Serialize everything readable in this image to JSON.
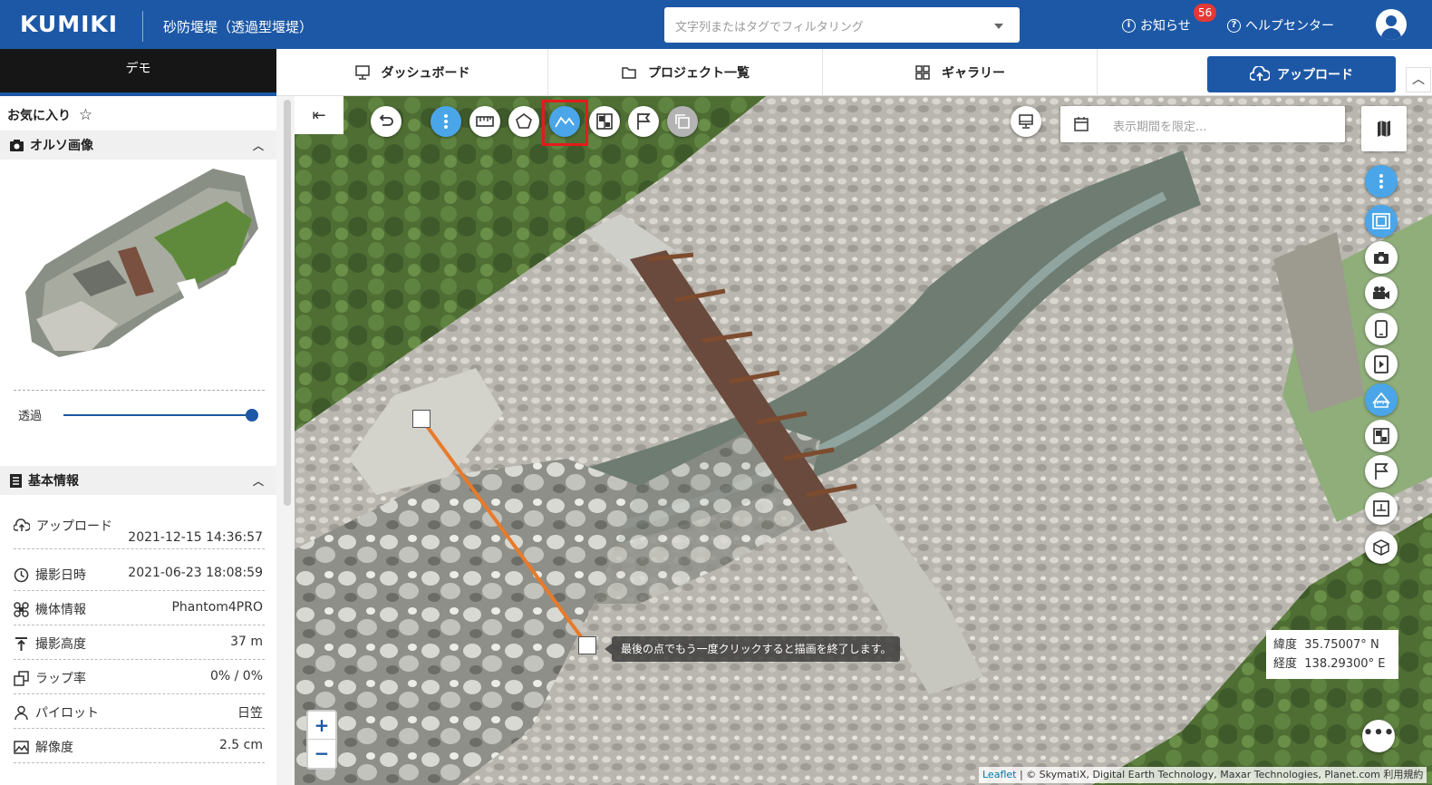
{
  "header": {
    "logo": "KUMIKI",
    "project_title": "砂防堰堤（透過型堰堤）",
    "filter_placeholder": "文字列またはタグでフィルタリング",
    "notifications_label": "お知らせ",
    "notifications_count": "56",
    "help_label": "ヘルプセンター",
    "brand_color": "#1d58a6"
  },
  "nav": {
    "org_tab": "デモ",
    "tabs": [
      {
        "label": "ダッシュボード",
        "icon": "monitor-icon"
      },
      {
        "label": "プロジェクト一覧",
        "icon": "folder-icon"
      },
      {
        "label": "ギャラリー",
        "icon": "grid-icon"
      }
    ],
    "upload_label": "アップロード"
  },
  "sidebar": {
    "favorites_label": "お気に入り",
    "ortho_section": "オルソ画像",
    "opacity_label": "透過",
    "opacity_value": 1.0,
    "basic_info_section": "基本情報",
    "info": [
      {
        "label": "アップロード",
        "value": "2021-12-15 14:36:57",
        "icon": "upload-icon"
      },
      {
        "label": "撮影日時",
        "value": "2021-06-23 18:08:59",
        "icon": "clock-icon"
      },
      {
        "label": "機体情報",
        "value": "Phantom4PRO",
        "icon": "drone-icon"
      },
      {
        "label": "撮影高度",
        "value": "37 m",
        "icon": "altitude-icon"
      },
      {
        "label": "ラップ率",
        "value": "0% / 0%",
        "icon": "overlap-icon"
      },
      {
        "label": "パイロット",
        "value": "日笠",
        "icon": "person-icon"
      },
      {
        "label": "解像度",
        "value": "2.5 cm",
        "icon": "image-icon"
      }
    ]
  },
  "map": {
    "date_placeholder": "表示期間を限定...",
    "tooltip": "最後の点でもう一度クリックすると描画を終了します。",
    "latitude_label": "緯度",
    "latitude_value": "35.75007° N",
    "longitude_label": "経度",
    "longitude_value": "138.29300° E",
    "attribution_link": "Leaflet",
    "attribution_text": " | © SkymatiX, Digital Earth Technology, Maxar Technologies, Planet.com 利用規約",
    "zoom_in": "+",
    "zoom_out": "−",
    "toolbar_icons": [
      "undo-icon",
      "more-vertical-icon",
      "ruler-icon",
      "polygon-icon",
      "profile-line-icon",
      "compare-icon",
      "flag-icon",
      "copy-icon"
    ],
    "right_icons": [
      "more-vertical-icon",
      "layer-frame-icon",
      "camera-icon",
      "video-icon",
      "tablet-icon",
      "document-icon",
      "measure-3d-icon",
      "compare-icon",
      "flag-icon",
      "board-icon",
      "cube-icon"
    ],
    "highlight_color": "#e21c1c",
    "line_color": "#e87a2a"
  }
}
